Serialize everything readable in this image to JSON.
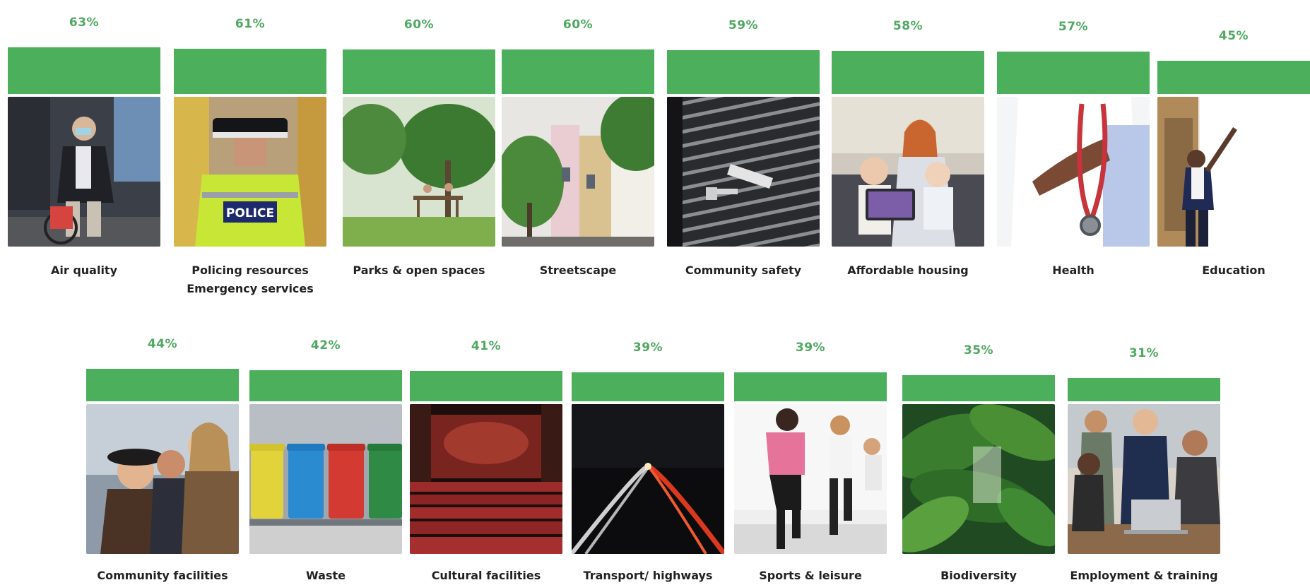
{
  "chart_data": {
    "type": "bar",
    "unit": "%",
    "colors": {
      "bar": "#4caf5c",
      "value_label": "#4fa862",
      "category_label": "#222222"
    },
    "rows": [
      [
        {
          "category": "Air quality",
          "value": 63,
          "value_label": "63%",
          "photo": "cyclist-with-mask-image"
        },
        {
          "category": "Policing resources\nEmergency services",
          "value": 61,
          "value_label": "61%",
          "photo": "police-officer-image"
        },
        {
          "category": "Parks & open spaces",
          "value": 60,
          "value_label": "60%",
          "photo": "park-image"
        },
        {
          "category": "Streetscape",
          "value": 60,
          "value_label": "60%",
          "photo": "terraced-street-image"
        },
        {
          "category": "Community safety",
          "value": 59,
          "value_label": "59%",
          "photo": "cctv-camera-image"
        },
        {
          "category": "Affordable housing",
          "value": 58,
          "value_label": "58%",
          "photo": "family-on-sofa-image"
        },
        {
          "category": "Health",
          "value": 57,
          "value_label": "57%",
          "photo": "doctor-stethoscope-image"
        },
        {
          "category": "Education",
          "value": 45,
          "value_label": "45%",
          "photo": "teacher-whiteboard-image"
        }
      ],
      [
        {
          "category": "Community facilities",
          "value": 44,
          "value_label": "44%",
          "photo": "friends-laughing-image"
        },
        {
          "category": "Waste",
          "value": 42,
          "value_label": "42%",
          "photo": "recycling-bins-image"
        },
        {
          "category": "Cultural facilities",
          "value": 41,
          "value_label": "41%",
          "photo": "theatre-seats-image"
        },
        {
          "category": "Transport/ highways",
          "value": 39,
          "value_label": "39%",
          "photo": "highway-night-image"
        },
        {
          "category": "Sports & leisure",
          "value": 39,
          "value_label": "39%",
          "photo": "fitness-class-image"
        },
        {
          "category": "Biodiversity",
          "value": 35,
          "value_label": "35%",
          "photo": "tropical-leaves-image"
        },
        {
          "category": "Employment & training",
          "value": 31,
          "value_label": "31%",
          "photo": "office-meeting-image"
        }
      ]
    ]
  }
}
